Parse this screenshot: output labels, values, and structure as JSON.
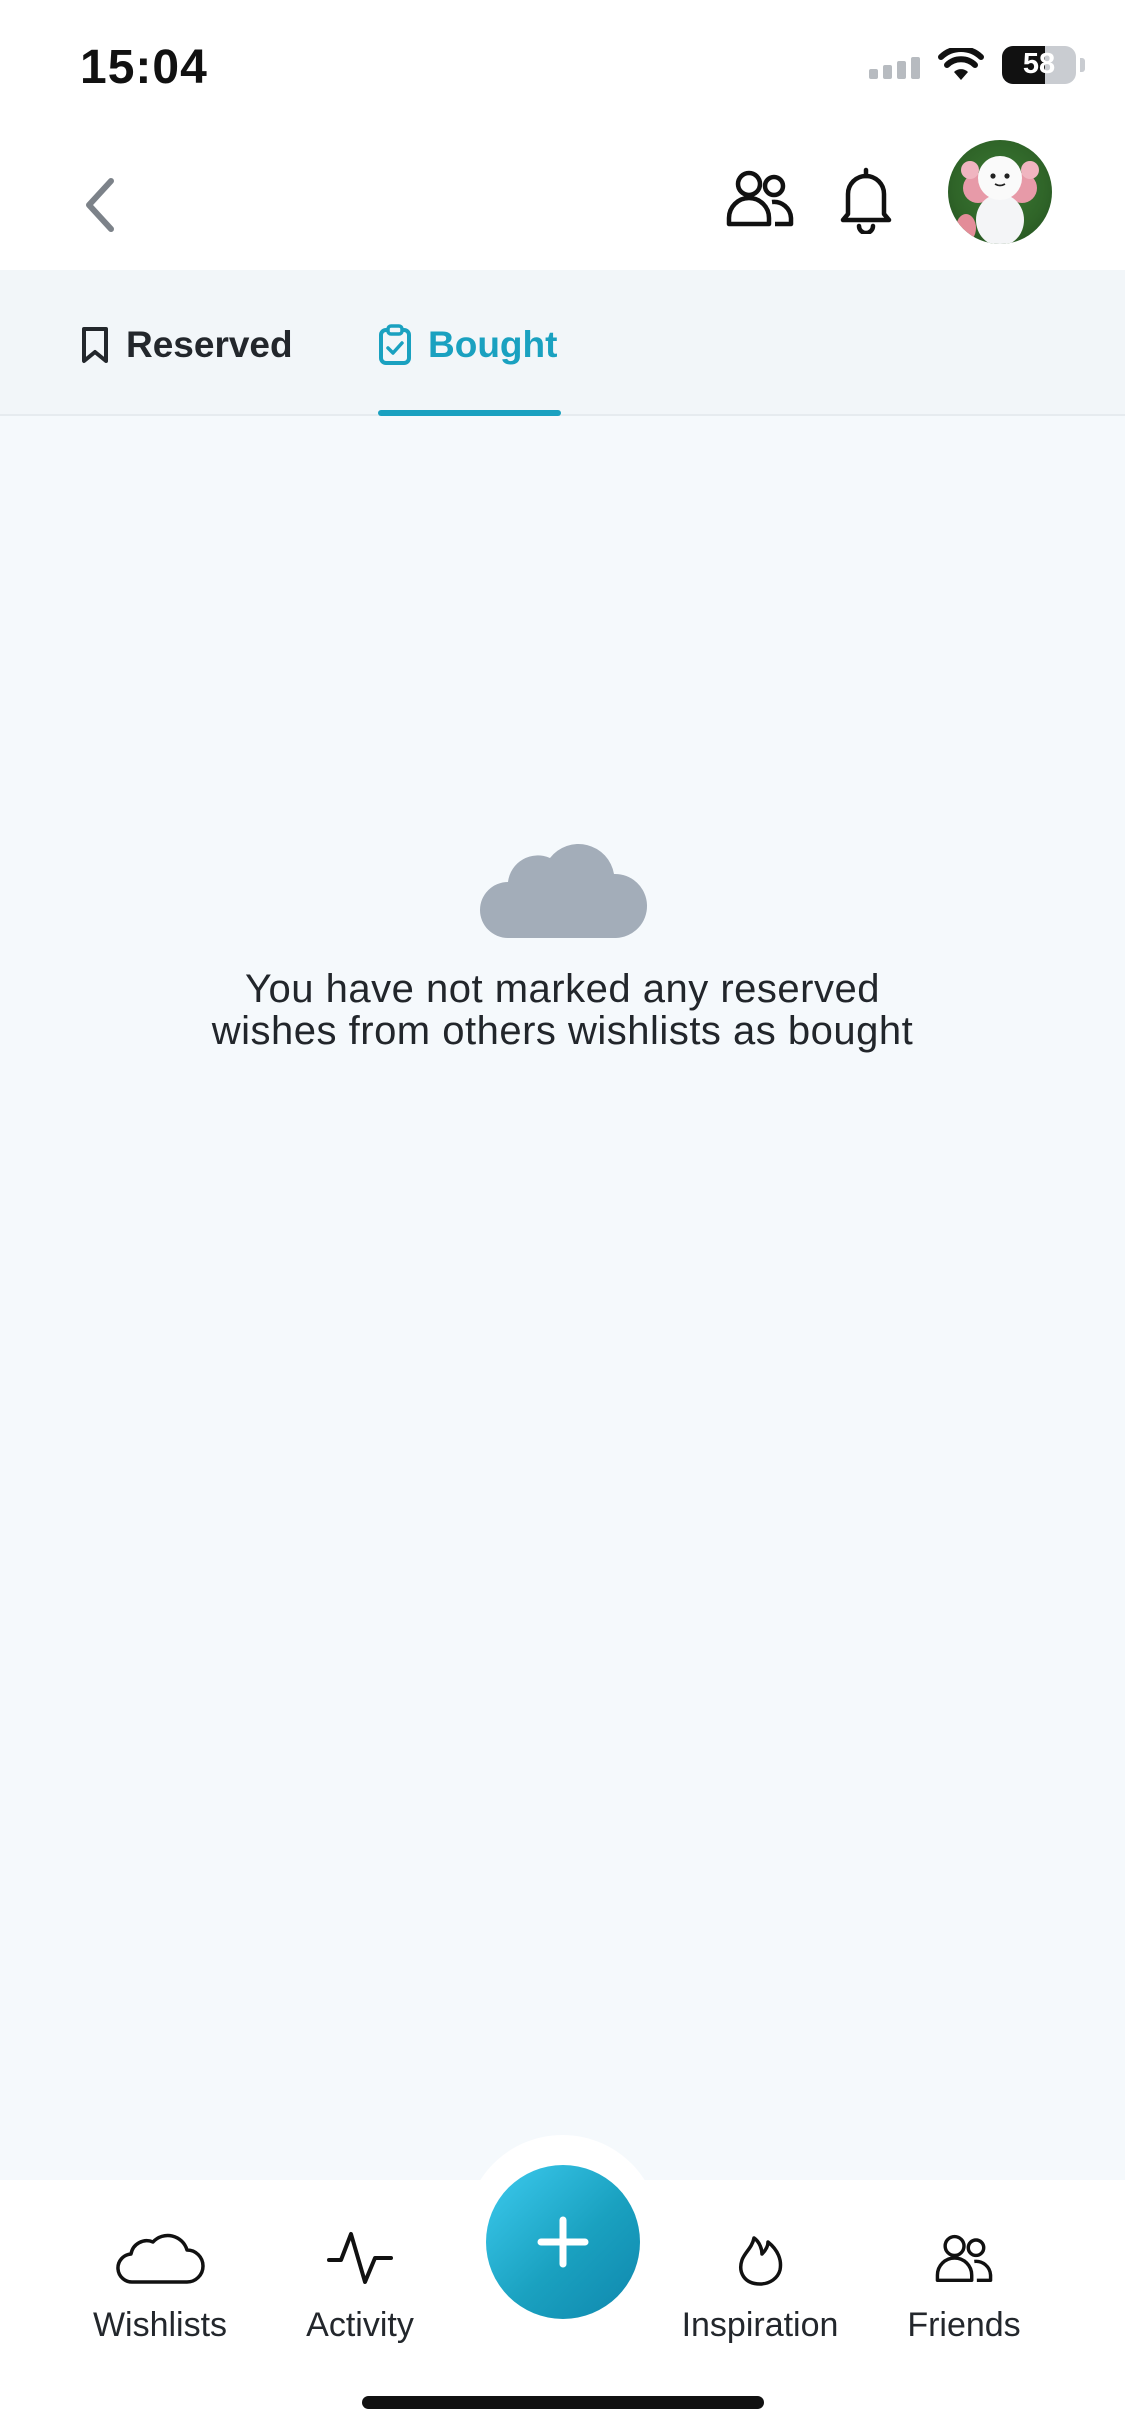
{
  "status_bar": {
    "time": "15:04",
    "battery": "58"
  },
  "header": {
    "back_icon": "chevron-left-icon",
    "friends_icon": "people-icon",
    "notifications_icon": "bell-icon",
    "avatar": "profile-avatar"
  },
  "tabs": [
    {
      "label": "Reserved",
      "icon": "bookmark-icon",
      "active": false
    },
    {
      "label": "Bought",
      "icon": "clipboard-check-icon",
      "active": true
    }
  ],
  "empty_state": {
    "icon": "cloud-icon",
    "message": "You have not marked any reserved wishes from others wishlists as bought"
  },
  "bottom_nav": {
    "items": [
      {
        "label": "Wishlists",
        "icon": "cloud-outline-icon"
      },
      {
        "label": "Activity",
        "icon": "activity-icon"
      },
      {
        "label": "Inspiration",
        "icon": "flame-icon"
      },
      {
        "label": "Friends",
        "icon": "people-icon"
      }
    ],
    "add_icon": "plus-icon"
  },
  "colors": {
    "accent": "#1aa1c0",
    "background": "#f5f9fc",
    "tab_bar": "#f2f6f9",
    "cloud": "#a3adb9"
  }
}
